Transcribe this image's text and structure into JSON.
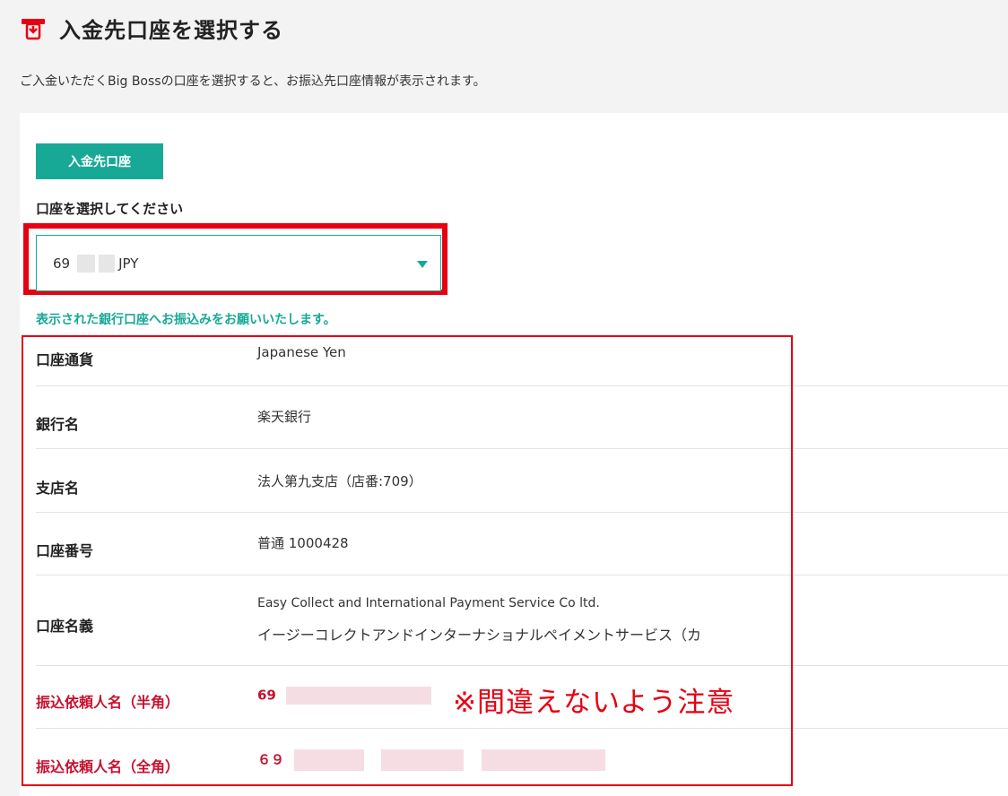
{
  "header": {
    "icon": "deposit-bank-icon",
    "title": "入金先口座を選択する"
  },
  "description": "ご入金いただくBig Bossの口座を選択すると、お振込先口座情報が表示されます。",
  "account_button": "入金先口座",
  "select": {
    "label": "口座を選択してください",
    "value_prefix": "69",
    "value_suffix": "JPY"
  },
  "notice": "表示された銀行口座へお振込みをお願いいたします。",
  "details": [
    {
      "label": "口座通貨",
      "value": "Japanese Yen"
    },
    {
      "label": "銀行名",
      "value": "楽天銀行"
    },
    {
      "label": "支店名",
      "value": "法人第九支店（店番:709）"
    },
    {
      "label": "口座番号",
      "value": "普通 1000428"
    },
    {
      "label": "口座名義",
      "value_line1": "Easy Collect and International Payment Service Co ltd.",
      "value_line2": "イージーコレクトアンドインターナショナルペイメントサービス（カ"
    },
    {
      "label": "振込依頼人名（半角）",
      "value": "69"
    },
    {
      "label": "振込依頼人名（全角）",
      "value": "６９"
    }
  ],
  "caution": "※間違えないよう注意",
  "colors": {
    "accent": "#17a996",
    "highlight": "#e60012",
    "warning_text": "#c8102e"
  }
}
